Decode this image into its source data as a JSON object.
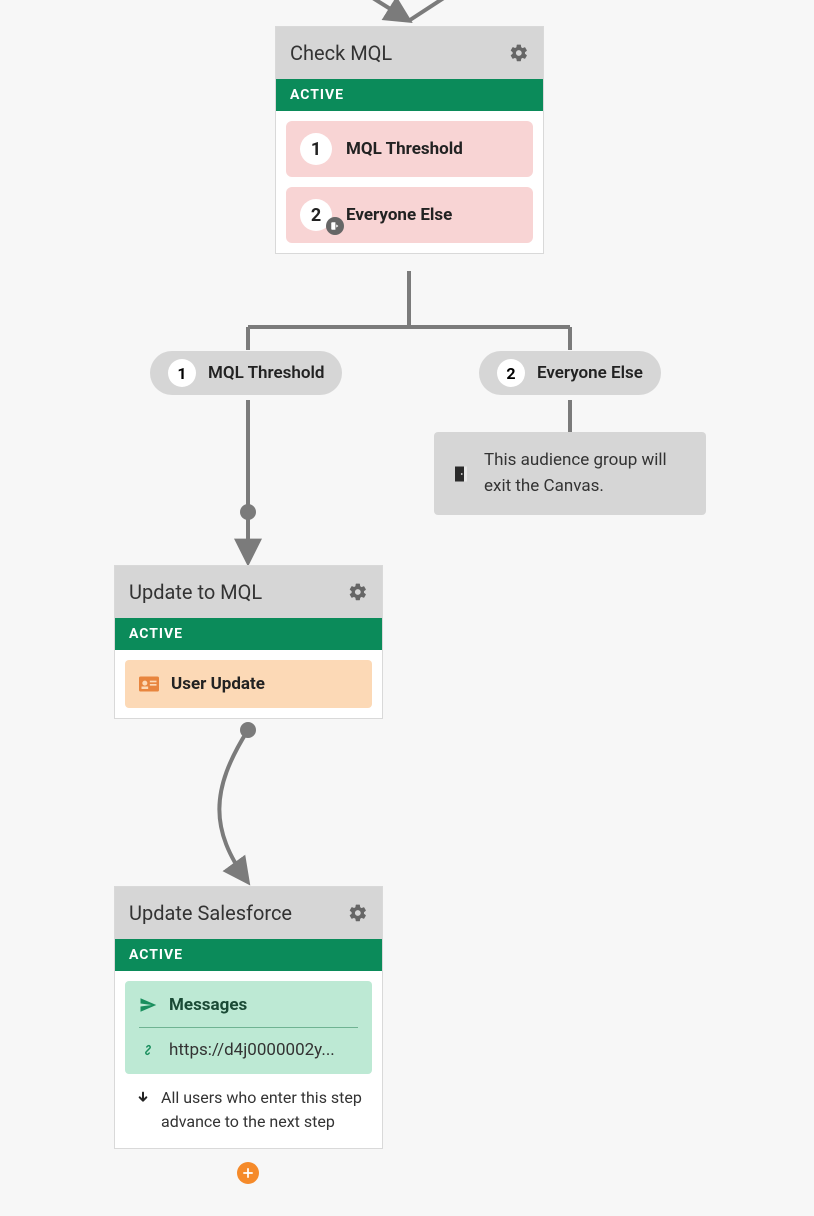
{
  "colors": {
    "active_green": "#0b8b5a",
    "path_pink": "#f8d4d4",
    "action_orange_bg": "#fcd9b6",
    "messages_green_bg": "#bde9d4",
    "plus_orange": "#f58a2a"
  },
  "nodes": {
    "check": {
      "title": "Check MQL",
      "status": "ACTIVE",
      "paths": [
        {
          "number": "1",
          "label": "MQL Threshold"
        },
        {
          "number": "2",
          "label": "Everyone Else"
        }
      ]
    },
    "update_mql": {
      "title": "Update to MQL",
      "status": "ACTIVE",
      "action": {
        "label": "User Update"
      }
    },
    "update_sf": {
      "title": "Update Salesforce",
      "status": "ACTIVE",
      "messages": {
        "label": "Messages",
        "url": "https://d4j0000002y..."
      },
      "advance_note": "All users who enter this step advance to the next step"
    }
  },
  "branch_pills": [
    {
      "number": "1",
      "label": "MQL Threshold"
    },
    {
      "number": "2",
      "label": "Everyone Else"
    }
  ],
  "exit_panel": {
    "text": "This audience group will exit the Canvas."
  }
}
